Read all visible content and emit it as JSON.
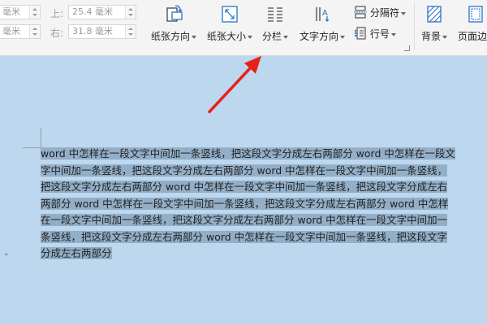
{
  "ribbon": {
    "margin_top_label": "上:",
    "margin_top_value": "25.4 毫米",
    "margin_left_value_cut": "毫米",
    "margin_right_label": "右:",
    "margin_right_value": "31.8 毫米",
    "margin_left_value2_cut": "毫米",
    "orientation": "纸张方向",
    "paper_size": "纸张大小",
    "columns": "分栏",
    "text_direction": "文字方向",
    "breaks": "分隔符",
    "line_numbers": "行号",
    "background": "背景",
    "page_border_cut": "页面边"
  },
  "document": {
    "lines": [
      "word 中怎样在一段文字中间加一条竖线，把这段文字分成左右两部分 word 中怎样在一段文",
      "字中间加一条竖线，把这段文字分成左右两部分 word 中怎样在一段文字中间加一条竖线，",
      "把这段文字分成左右两部分 word 中怎样在一段文字中间加一条竖线，把这段文字分成左右",
      "两部分 word 中怎样在一段文字中间加一条竖线，把这段文字分成左右两部分 word 中怎样",
      "在一段文字中间加一条竖线，把这段文字分成左右两部分 word 中怎样在一段文字中间加一",
      "条竖线，把这段文字分成左右两部分 word 中怎样在一段文字中间加一条竖线，把这段文字",
      "分成左右两部分"
    ]
  },
  "colors": {
    "page_bg": "#bcd7ee",
    "selection": "#93aec7",
    "arrow": "#e8211b",
    "icon_blue": "#2a72c6"
  }
}
